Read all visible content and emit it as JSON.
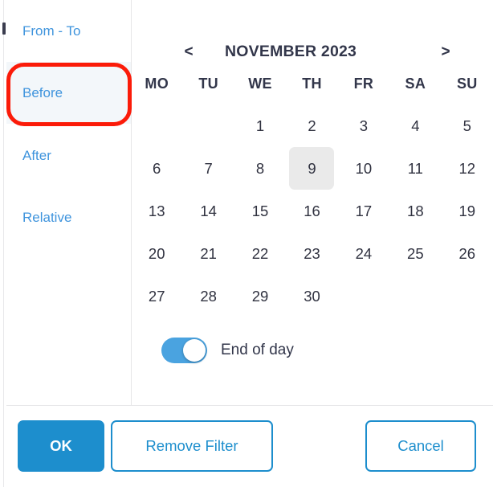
{
  "dialog": {
    "name": "date-filter-picker"
  },
  "sidebar": {
    "items": [
      {
        "label": "From - To",
        "active": false
      },
      {
        "label": "Before",
        "active": true
      },
      {
        "label": "After",
        "active": false
      },
      {
        "label": "Relative",
        "active": false
      }
    ]
  },
  "calendar": {
    "title": "NOVEMBER 2023",
    "month": "NOVEMBER",
    "year": "2023",
    "prev_label": "<",
    "next_label": ">",
    "weekdays": [
      "MO",
      "TU",
      "WE",
      "TH",
      "FR",
      "SA",
      "SU"
    ],
    "leading_blanks": 2,
    "days": [
      "1",
      "2",
      "3",
      "4",
      "5",
      "6",
      "7",
      "8",
      "9",
      "10",
      "11",
      "12",
      "13",
      "14",
      "15",
      "16",
      "17",
      "18",
      "19",
      "20",
      "21",
      "22",
      "23",
      "24",
      "25",
      "26",
      "27",
      "28",
      "29",
      "30"
    ],
    "selected_day": "9"
  },
  "toggle": {
    "label": "End of day",
    "checked": true
  },
  "footer": {
    "ok_label": "OK",
    "remove_filter_label": "Remove Filter",
    "cancel_label": "Cancel"
  },
  "annotation": {
    "target": "Before",
    "color": "#fb1b09"
  },
  "colors": {
    "accent": "#1d8ecd",
    "link": "#3f94dd",
    "text": "#32364a",
    "active_row_bg": "#f3f7fa",
    "selected_day_bg": "#eaeaea",
    "toggle_on": "#4aa3e0",
    "divider": "#e6e6e8"
  }
}
